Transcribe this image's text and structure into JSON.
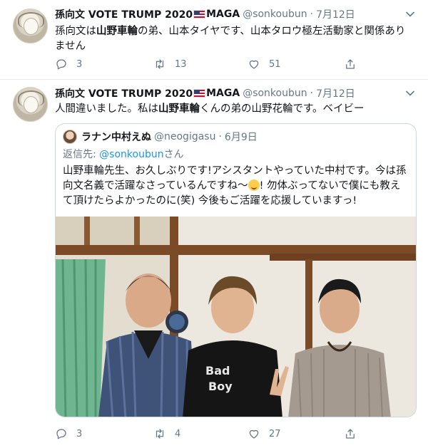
{
  "tweets": [
    {
      "name": "孫向文 VOTE TRUMP 2020",
      "name_suffix": "MAGA",
      "handle": "@sonkoubun",
      "dot": "·",
      "date": "7月12日",
      "text_prefix": "孫向文は",
      "text_bold": "山野車輪",
      "text_suffix": "の弟、山本タイヤです、山本タロウ極左活動家と関係ありません",
      "replies": "3",
      "retweets": "13",
      "likes": "51"
    },
    {
      "name": "孫向文 VOTE TRUMP 2020",
      "name_suffix": "MAGA",
      "handle": "@sonkoubun",
      "dot": "·",
      "date": "7月12日",
      "text_prefix": "人間違いました。私は",
      "text_bold": "山野車輪",
      "text_suffix": "くんの弟の山野花輪です。ベイビー",
      "replies": "3",
      "retweets": "4",
      "likes": "27",
      "quote": {
        "name": "ラナン中村えぬ",
        "handle": "@neogigasu",
        "dot": "·",
        "date": "6月9日",
        "reply_prefix": "返信先: ",
        "reply_handle": "@sonkoubun",
        "reply_suffix": "さん",
        "text_part1": "山野車輪先生、お久しぶりです!アシスタントやっていた中村です。今は孫向文名義で活躍なさっているんですね〜",
        "text_part2": "! 勿体ぶってないで僕にも教えて頂けたらよかったのに(笑) 今後もご活躍を応援していますっ!"
      }
    }
  ],
  "icons": {
    "reply": "reply-icon",
    "retweet": "retweet-icon",
    "like": "heart-icon",
    "share": "share-icon",
    "more": "chevron-down-icon"
  },
  "colors": {
    "accent": "#1b95e0",
    "secondary_text": "#657786",
    "border": "#e6ecf0"
  }
}
